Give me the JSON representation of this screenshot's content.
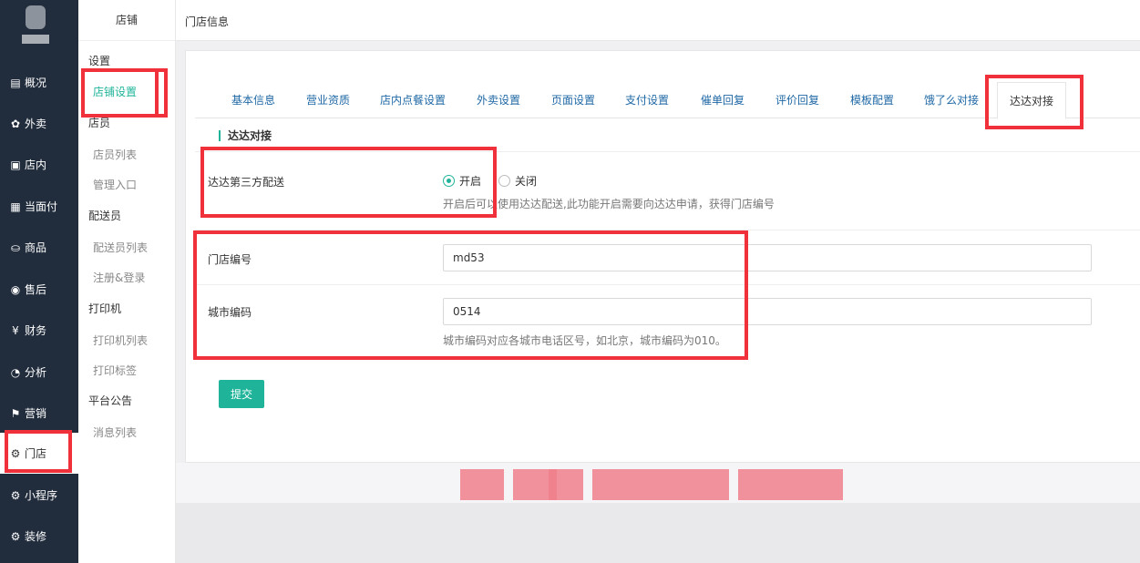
{
  "nav": {
    "items": [
      {
        "icon": "▤",
        "label": "概况"
      },
      {
        "icon": "✿",
        "label": "外卖"
      },
      {
        "icon": "▣",
        "label": "店内"
      },
      {
        "icon": "▦",
        "label": "当面付"
      },
      {
        "icon": "⛀",
        "label": "商品"
      },
      {
        "icon": "◉",
        "label": "售后"
      },
      {
        "icon": "¥",
        "label": "财务"
      },
      {
        "icon": "◔",
        "label": "分析"
      },
      {
        "icon": "⚑",
        "label": "营销"
      },
      {
        "icon": "⚙",
        "label": "门店"
      },
      {
        "icon": "⚙",
        "label": "小程序"
      },
      {
        "icon": "⚙",
        "label": "装修"
      }
    ]
  },
  "subnav": {
    "title": "店铺",
    "groups": [
      {
        "head": "设置",
        "items": [
          "店铺设置"
        ]
      },
      {
        "head": "店员",
        "items": [
          "店员列表",
          "管理入口"
        ]
      },
      {
        "head": "配送员",
        "items": [
          "配送员列表",
          "注册&登录"
        ]
      },
      {
        "head": "打印机",
        "items": [
          "打印机列表",
          "打印标签"
        ]
      },
      {
        "head": "平台公告",
        "items": [
          "消息列表"
        ]
      }
    ]
  },
  "header": {
    "title": "门店信息"
  },
  "tabs": [
    "基本信息",
    "营业资质",
    "店内点餐设置",
    "外卖设置",
    "页面设置",
    "支付设置",
    "催单回复",
    "评价回复",
    "模板配置",
    "饿了么对接",
    "达达对接"
  ],
  "section": {
    "title": "达达对接"
  },
  "form": {
    "dada_label": "达达第三方配送",
    "opt_on": "开启",
    "opt_off": "关闭",
    "dada_help": "开启后可以使用达达配送,此功能开启需要向达达申请，获得门店编号",
    "store_no_label": "门店编号",
    "store_no_value": "md53",
    "city_code_label": "城市编码",
    "city_code_value": "0514",
    "city_code_help": "城市编码对应各城市电话区号，如北京，城市编码为010。",
    "submit_label": "提交"
  },
  "colors": {
    "accent": "#1fb49a",
    "sidebar": "#212c3c",
    "highlight": "#f0303a",
    "tab_link": "#1f68a5"
  }
}
